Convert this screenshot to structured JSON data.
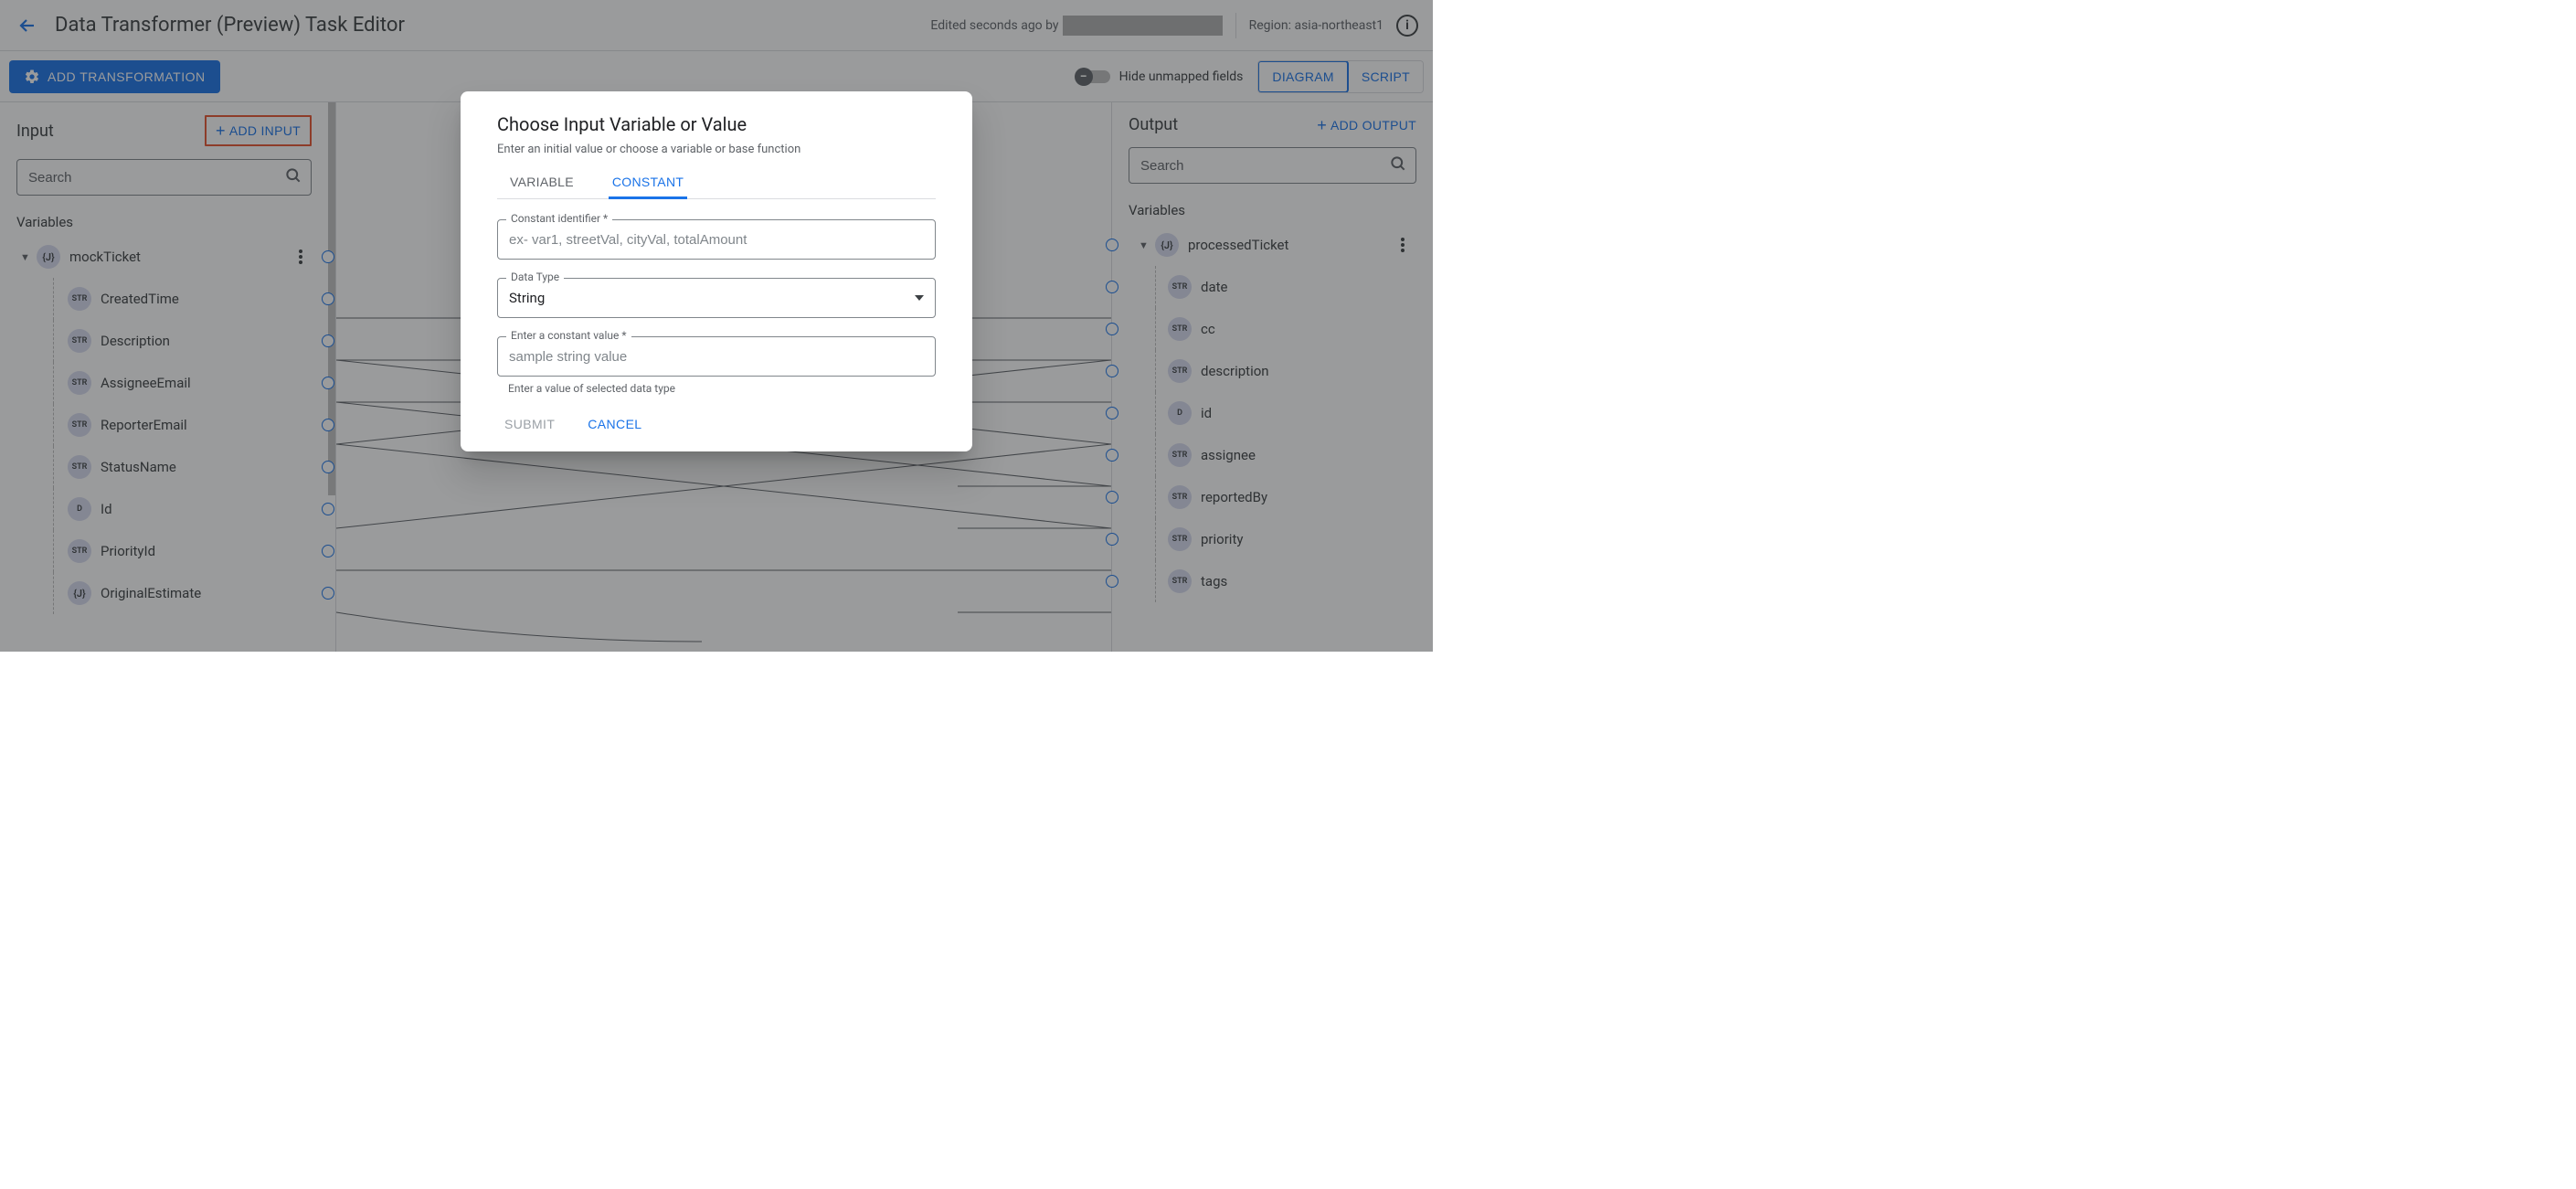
{
  "header": {
    "title": "Data Transformer (Preview) Task Editor",
    "edited_prefix": "Edited seconds ago by ",
    "region_label": "Region: asia-northeast1"
  },
  "toolbar": {
    "add_transform_label": "ADD TRANSFORMATION",
    "hide_unmapped_label": "Hide unmapped fields",
    "view_diagram": "DIAGRAM",
    "view_script": "SCRIPT"
  },
  "panels": {
    "input_title": "Input",
    "add_input_label": "ADD INPUT",
    "output_title": "Output",
    "add_output_label": "ADD OUTPUT",
    "search_placeholder": "Search",
    "variables_label": "Variables"
  },
  "input_tree": {
    "root": {
      "type": "{J}",
      "label": "mockTicket"
    },
    "children": [
      {
        "type": "STR",
        "label": "CreatedTime"
      },
      {
        "type": "STR",
        "label": "Description"
      },
      {
        "type": "STR",
        "label": "AssigneeEmail"
      },
      {
        "type": "STR",
        "label": "ReporterEmail"
      },
      {
        "type": "STR",
        "label": "StatusName"
      },
      {
        "type": "D",
        "label": "Id"
      },
      {
        "type": "STR",
        "label": "PriorityId"
      },
      {
        "type": "{J}",
        "label": "OriginalEstimate"
      }
    ]
  },
  "output_tree": {
    "root": {
      "type": "{J}",
      "label": "processedTicket"
    },
    "children": [
      {
        "type": "STR",
        "label": "date"
      },
      {
        "type": "STR",
        "label": "cc"
      },
      {
        "type": "STR",
        "label": "description"
      },
      {
        "type": "D",
        "label": "id"
      },
      {
        "type": "STR",
        "label": "assignee"
      },
      {
        "type": "STR",
        "label": "reportedBy"
      },
      {
        "type": "STR",
        "label": "priority"
      },
      {
        "type": "STR",
        "label": "tags"
      }
    ]
  },
  "modal": {
    "title": "Choose Input Variable or Value",
    "subtitle": "Enter an initial value or choose a variable or base function",
    "tab_variable": "VARIABLE",
    "tab_constant": "CONSTANT",
    "field_identifier_label": "Constant identifier *",
    "field_identifier_placeholder": "ex- var1, streetVal, cityVal, totalAmount",
    "field_datatype_label": "Data Type",
    "field_datatype_value": "String",
    "field_value_label": "Enter a constant value *",
    "field_value_placeholder": "sample string value",
    "helper_text": "Enter a value of selected data type",
    "submit_label": "SUBMIT",
    "cancel_label": "CANCEL"
  }
}
